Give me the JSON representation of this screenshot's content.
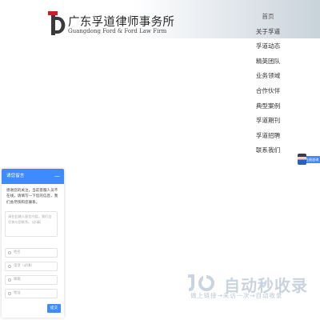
{
  "header": {
    "logo_cn": "广东孚道律师事务所",
    "logo_en": "Guangdong Ford & Ford Law Firm"
  },
  "nav": {
    "items": [
      "首页",
      "关于孚道",
      "孚道动态",
      "精英团队",
      "业务领域",
      "合作伙伴",
      "典型案例",
      "孚道期刊",
      "孚道招聘",
      "联系我们"
    ]
  },
  "chat_float": {
    "label": "在线咨询"
  },
  "panel": {
    "title": "请您留言",
    "minimize": "—",
    "message": "感谢您的关注，当前客服人员不在线，请填写一下您的信息，我们会尽快和您联系。",
    "textarea_placeholder": "请在此输入留言内容，我们会尽快与您联系。（必填）",
    "fields": [
      {
        "placeholder": "姓名",
        "icon": "person-icon"
      },
      {
        "placeholder": "电话（必填）",
        "icon": "phone-icon"
      },
      {
        "placeholder": "邮箱",
        "icon": "mail-icon"
      },
      {
        "placeholder": "地址",
        "icon": "location-icon"
      }
    ],
    "submit": "提交"
  },
  "watermark": {
    "text": "自动秒收录",
    "subtitle": "做上链接→来访一次→自动收录"
  },
  "colors": {
    "accent": "#3d8bff",
    "logo_red": "#c8202a",
    "logo_dark": "#3a3a3a",
    "watermark": "#c9d4de"
  }
}
